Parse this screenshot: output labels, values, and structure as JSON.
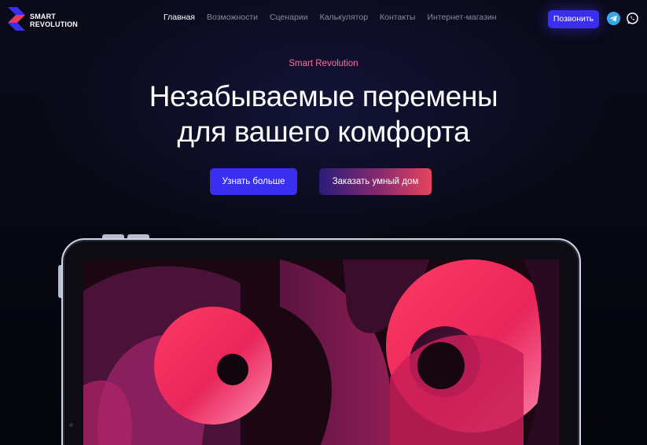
{
  "brand": {
    "line1": "SMART",
    "line2": "REVOLUTION"
  },
  "nav": {
    "items": [
      "Главная",
      "Возможности",
      "Сценарии",
      "Калькулятор",
      "Контакты",
      "Интернет-магазин"
    ]
  },
  "header": {
    "call_label": "Позвонить"
  },
  "hero": {
    "kicker": "Smart Revolution",
    "title_line1": "Незабываемые перемены",
    "title_line2": "для вашего комфорта",
    "primary_button": "Узнать больше",
    "secondary_button": "Заказать умный дом"
  },
  "colors": {
    "accent_blue": "#3a2ff0",
    "accent_pink": "#ff6fa3",
    "background": "#07070f"
  },
  "icons": {
    "telegram": "telegram-icon",
    "whatsapp": "whatsapp-icon",
    "logo": "logo-mark-icon"
  }
}
